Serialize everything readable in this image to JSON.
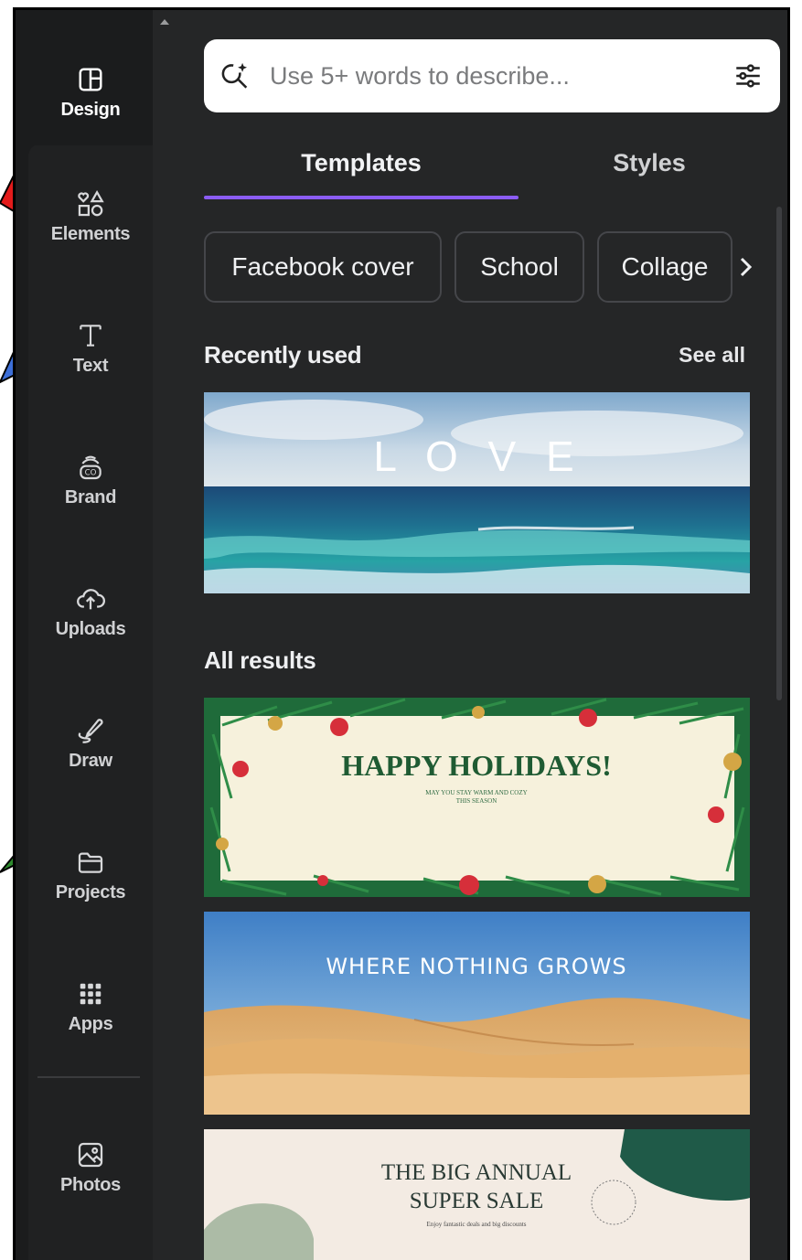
{
  "sidebar": {
    "items": [
      {
        "label": "Design",
        "icon": "layout-icon"
      },
      {
        "label": "Elements",
        "icon": "shapes-icon"
      },
      {
        "label": "Text",
        "icon": "text-icon"
      },
      {
        "label": "Brand",
        "icon": "brand-icon"
      },
      {
        "label": "Uploads",
        "icon": "cloud-upload-icon"
      },
      {
        "label": "Draw",
        "icon": "pen-icon"
      },
      {
        "label": "Projects",
        "icon": "folder-icon"
      },
      {
        "label": "Apps",
        "icon": "grid-icon"
      },
      {
        "label": "Photos",
        "icon": "image-icon"
      }
    ]
  },
  "search": {
    "placeholder": "Use 5+ words to describe...",
    "value": ""
  },
  "tabs": [
    {
      "label": "Templates",
      "active": true
    },
    {
      "label": "Styles",
      "active": false
    }
  ],
  "chips": [
    "Facebook cover",
    "School",
    "Collage"
  ],
  "recent": {
    "title": "Recently used",
    "see_all": "See all",
    "items": [
      {
        "text": "L O V E"
      }
    ]
  },
  "results": {
    "title": "All results",
    "items": [
      {
        "title": "HAPPY HOLIDAYS!",
        "subtitle_line1": "MAY YOU STAY WARM AND COZY",
        "subtitle_line2": "THIS SEASON"
      },
      {
        "title": "WHERE NOTHING GROWS"
      },
      {
        "title_line1": "THE BIG ANNUAL",
        "title_line2": "SUPER SALE",
        "subtitle": "Enjoy fantastic deals and big discounts"
      }
    ]
  },
  "colors": {
    "accent": "#8b5cf6",
    "panel_bg": "#252627",
    "rail_bg": "#1b1c1d"
  }
}
